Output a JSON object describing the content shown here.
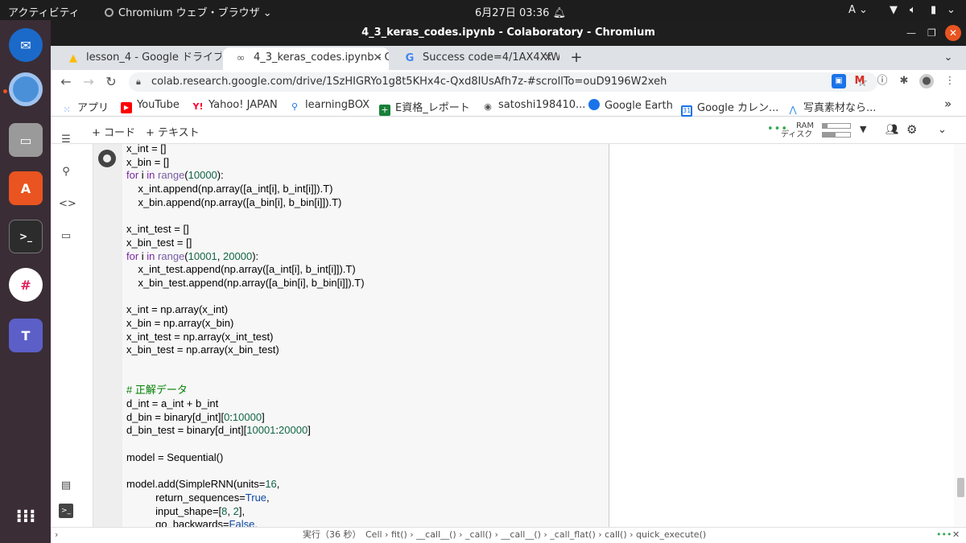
{
  "topbar": {
    "activities": "アクティビティ",
    "app_menu": "Chromium ウェブ・ブラウザ",
    "datetime": "6月27日 03:36",
    "input_method": "A"
  },
  "window": {
    "title": "4_3_keras_codes.ipynb - Colaboratory - Chromium"
  },
  "tabs": [
    {
      "label": "lesson_4 - Google ドライブ",
      "favicon": "google-drive-icon"
    },
    {
      "label": "4_3_keras_codes.ipynb - C",
      "favicon": "colab-icon"
    },
    {
      "label": "Success code=4/1AX4XfW",
      "favicon": "google-g-icon"
    }
  ],
  "address": {
    "url": "colab.research.google.com/drive/1SzHIGRYo1g8t5KHx4c-Qxd8IUsAfh7z-#scrollTo=ouD9196W2xeh"
  },
  "bookmarks": [
    {
      "label": "アプリ",
      "icon": "apps-grid-icon",
      "color": "#4285f4"
    },
    {
      "label": "YouTube",
      "icon": "youtube-icon",
      "color": "#ff0000"
    },
    {
      "label": "Yahoo! JAPAN",
      "icon": "yahoo-icon",
      "color": "#ff0033"
    },
    {
      "label": "learningBOX",
      "icon": "learningbox-icon",
      "color": "#1a73e8"
    },
    {
      "label": "E資格_レポート",
      "icon": "sheets-icon",
      "color": "#188038"
    },
    {
      "label": "satoshi198410...",
      "icon": "octocat-icon",
      "color": "#555555"
    },
    {
      "label": "Google Earth",
      "icon": "earth-icon",
      "color": "#1a73e8"
    },
    {
      "label": "Google カレン...",
      "icon": "calendar-icon",
      "color": "#1a73e8"
    },
    {
      "label": "写真素材なら...",
      "icon": "photo-icon",
      "color": "#1e88e5"
    }
  ],
  "colab": {
    "add_code": "+ コード",
    "add_text": "+ テキスト",
    "ram_label": "RAM",
    "disk_label": "ディスク"
  },
  "code_lines": [
    [
      {
        "t": "x_int = []"
      }
    ],
    [
      {
        "t": "x_bin = []"
      }
    ],
    [
      {
        "t": "for",
        "c": "kw"
      },
      {
        "t": " i "
      },
      {
        "t": "in",
        "c": "kw"
      },
      {
        "t": " "
      },
      {
        "t": "range",
        "c": "bi"
      },
      {
        "t": "("
      },
      {
        "t": "10000",
        "c": "num"
      },
      {
        "t": "):"
      }
    ],
    [
      {
        "t": "    x_int.append(np.array([a_int[i], b_int[i]]).T)"
      }
    ],
    [
      {
        "t": "    x_bin.append(np.array([a_bin[i], b_bin[i]]).T)"
      }
    ],
    [],
    [
      {
        "t": "x_int_test = []"
      }
    ],
    [
      {
        "t": "x_bin_test = []"
      }
    ],
    [
      {
        "t": "for",
        "c": "kw"
      },
      {
        "t": " i "
      },
      {
        "t": "in",
        "c": "kw"
      },
      {
        "t": " "
      },
      {
        "t": "range",
        "c": "bi"
      },
      {
        "t": "("
      },
      {
        "t": "10001",
        "c": "num"
      },
      {
        "t": ", "
      },
      {
        "t": "20000",
        "c": "num"
      },
      {
        "t": "):"
      }
    ],
    [
      {
        "t": "    x_int_test.append(np.array([a_int[i], b_int[i]]).T)"
      }
    ],
    [
      {
        "t": "    x_bin_test.append(np.array([a_bin[i], b_bin[i]]).T)"
      }
    ],
    [],
    [
      {
        "t": "x_int = np.array(x_int)"
      }
    ],
    [
      {
        "t": "x_bin = np.array(x_bin)"
      }
    ],
    [
      {
        "t": "x_int_test = np.array(x_int_test)"
      }
    ],
    [
      {
        "t": "x_bin_test = np.array(x_bin_test)"
      }
    ],
    [],
    [],
    [
      {
        "t": "# 正解データ",
        "c": "cm"
      }
    ],
    [
      {
        "t": "d_int = a_int + b_int"
      }
    ],
    [
      {
        "t": "d_bin = binary[d_int]["
      },
      {
        "t": "0",
        "c": "num"
      },
      {
        "t": ":"
      },
      {
        "t": "10000",
        "c": "num"
      },
      {
        "t": "]"
      }
    ],
    [
      {
        "t": "d_bin_test = binary[d_int]["
      },
      {
        "t": "10001",
        "c": "num"
      },
      {
        "t": ":"
      },
      {
        "t": "20000",
        "c": "num"
      },
      {
        "t": "]"
      }
    ],
    [],
    [
      {
        "t": "model = Sequential()"
      }
    ],
    [],
    [
      {
        "t": "model.add(SimpleRNN(units="
      },
      {
        "t": "16",
        "c": "num"
      },
      {
        "t": ","
      }
    ],
    [
      {
        "t": "          return_sequences="
      },
      {
        "t": "True",
        "c": "tr"
      },
      {
        "t": ","
      }
    ],
    [
      {
        "t": "          input_shape=["
      },
      {
        "t": "8",
        "c": "num"
      },
      {
        "t": ", "
      },
      {
        "t": "2",
        "c": "num"
      },
      {
        "t": "],"
      }
    ],
    [
      {
        "t": "          go_backwards="
      },
      {
        "t": "False",
        "c": "tr"
      },
      {
        "t": ","
      }
    ]
  ],
  "status": {
    "running": "実行（36 秒）",
    "trace": "Cell › fit() › __call__() › _call() › __call__() › _call_flat() › call() › quick_execute()"
  }
}
